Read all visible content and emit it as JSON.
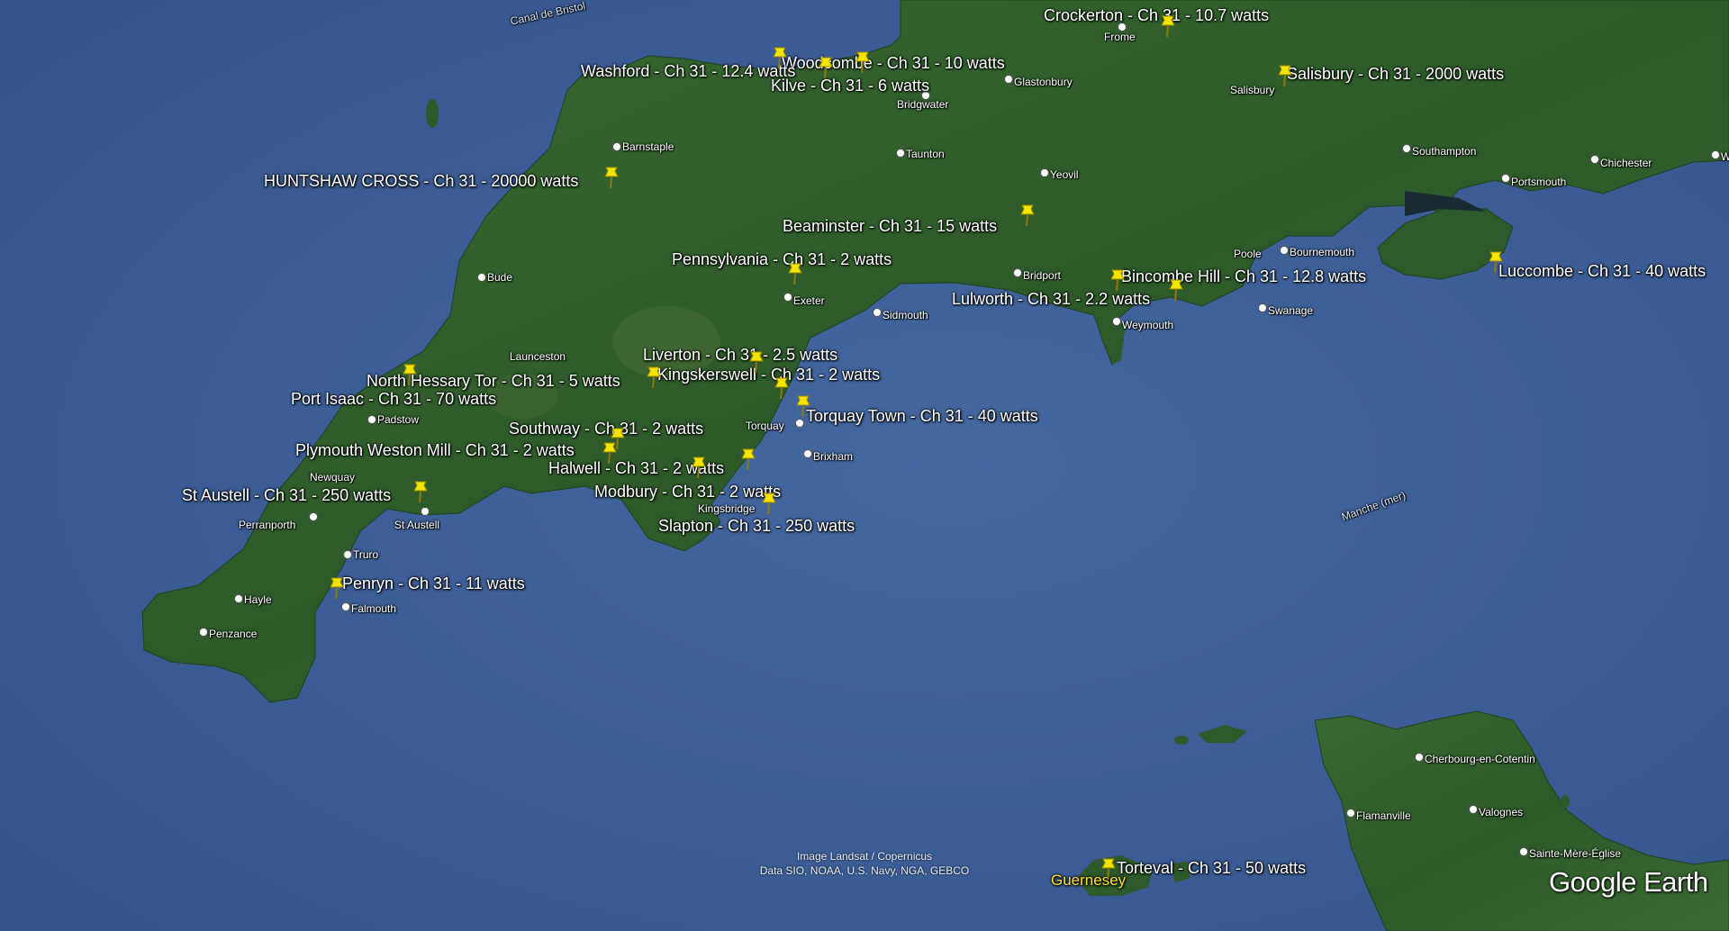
{
  "places": {
    "canal_de_bristol": "Canal de Bristol",
    "barnstaple": "Barnstaple",
    "bude": "Bude",
    "launceston": "Launceston",
    "padstow": "Padstow",
    "newquay": "Newquay",
    "perranporth": "Perranporth",
    "st_austell": "St Austell",
    "truro": "Truro",
    "hayle": "Hayle",
    "falmouth": "Falmouth",
    "penzance": "Penzance",
    "exeter": "Exeter",
    "sidmouth": "Sidmouth",
    "torquay": "Torquay",
    "brixham": "Brixham",
    "kingsbridge": "Kingsbridge",
    "taunton": "Taunton",
    "bridgwater": "Bridgwater",
    "glastonbury": "Glastonbury",
    "frome": "Frome",
    "yeovil": "Yeovil",
    "bridport": "Bridport",
    "weymouth": "Weymouth",
    "poole": "Poole",
    "bournemouth": "Bournemouth",
    "swanage": "Swanage",
    "salisbury": "Salisbury",
    "southampton": "Southampton",
    "portsmouth": "Portsmouth",
    "chichester": "Chichester",
    "w_edge": "W",
    "manche": "Manche (mer)",
    "cherbourg": "Cherbourg-en-Cotentin",
    "flamanville": "Flamanville",
    "valognes": "Valognes",
    "sainte_mere": "Sainte-Mère-Église",
    "guernesey": "Guernesey"
  },
  "transmitters": {
    "crockerton": "Crockerton - Ch 31 - 10.7 watts",
    "woodcombe": "Woodcombe - Ch 31 - 10 watts",
    "washford": "Washford - Ch 31 - 12.4 watts",
    "kilve": "Kilve - Ch 31 - 6 watts",
    "salisbury": "Salisbury - Ch 31 - 2000 watts",
    "huntshaw": "HUNTSHAW CROSS - Ch 31 - 20000 watts",
    "beaminster": "Beaminster - Ch 31 - 15 watts",
    "pennsylvania": "Pennsylvania - Ch 31 - 2 watts",
    "bincombe": "Bincombe Hill - Ch 31 - 12.8 watts",
    "luccombe": "Luccombe - Ch 31 - 40 watts",
    "lulworth": "Lulworth - Ch 31 - 2.2 watts",
    "liverton": "Liverton - Ch 31 - 2.5 watts",
    "north_hessary": "North Hessary Tor - Ch 31 - 5 watts",
    "kingskerswell": "Kingskerswell - Ch 31 - 2 watts",
    "port_isaac": "Port Isaac - Ch 31 - 70 watts",
    "torquay": "Torquay Town - Ch 31 - 40 watts",
    "southway": "Southway - Ch 31 - 2 watts",
    "plymouth": "Plymouth Weston Mill - Ch 31 - 2 watts",
    "halwell": "Halwell - Ch 31 - 2 watts",
    "st_austell": "St Austell - Ch 31 - 250 watts",
    "modbury": "Modbury - Ch 31 - 2 watts",
    "slapton": "Slapton - Ch 31 - 250 watts",
    "penryn": "Penryn - Ch 31 - 11 watts",
    "torteval": "Torteval - Ch 31 - 50 watts"
  },
  "attribution": {
    "line1": "Image Landsat / Copernicus",
    "line2": "Data SIO, NOAA, U.S. Navy, NGA, GEBCO"
  },
  "logo": "Google Earth",
  "colors": {
    "sea": "#3c5c92",
    "land": "#2f5a2b",
    "pin": "#f5e400"
  }
}
